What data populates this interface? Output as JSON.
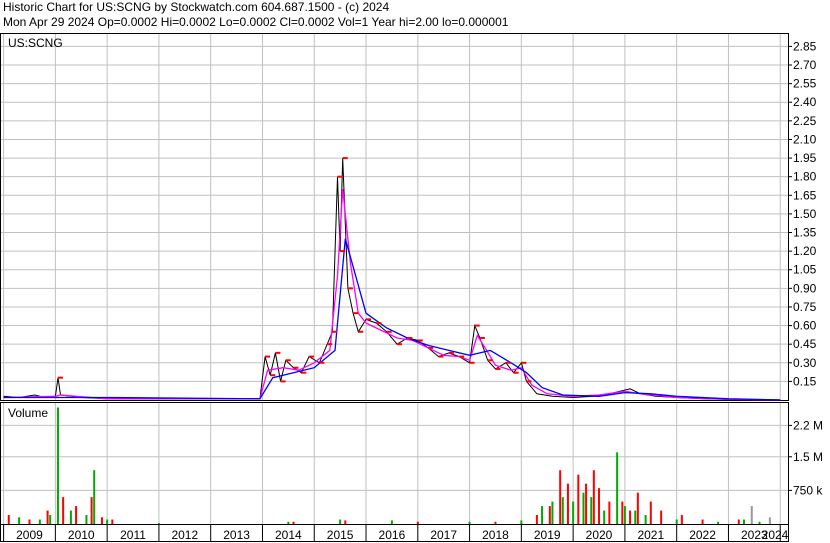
{
  "header": {
    "line1": "Historic Chart for US:SCNG by Stockwatch.com 604.687.1500 - (c) 2024",
    "line2": "Mon Apr 29 2024   Op=0.0002  Hi=0.0002  Lo=0.0002  Cl=0.0002  Vol=1   Year hi=2.00   lo=0.000001"
  },
  "colors": {
    "price": "#000000",
    "ma_short": "#ff00ff",
    "ma_long": "#0000ff",
    "marker": "#ff0000",
    "vol_up": "#00aa00",
    "vol_down": "#ff0000",
    "vol_flat": "#999999",
    "grid": "#c0c0c0"
  },
  "chart_data": [
    {
      "type": "line",
      "title": "US:SCNG",
      "ylim": [
        0,
        2.95
      ],
      "y_ticks": [
        "2.85",
        "2.70",
        "2.55",
        "2.40",
        "2.25",
        "2.10",
        "1.95",
        "1.80",
        "1.65",
        "1.50",
        "1.35",
        "1.20",
        "1.05",
        "0.90",
        "0.75",
        "0.60",
        "0.45",
        "0.30",
        "0.15"
      ],
      "x_ticks": [
        "2009",
        "2010",
        "2011",
        "2012",
        "2013",
        "2014",
        "2015",
        "2016",
        "2017",
        "2018",
        "2019",
        "2020",
        "2021",
        "2022",
        "2023",
        "2024"
      ],
      "series": [
        {
          "values": [
            [
              2009.0,
              0.03
            ],
            [
              2009.3,
              0.02
            ],
            [
              2009.6,
              0.04
            ],
            [
              2009.8,
              0.02
            ],
            [
              2010.0,
              0.03
            ],
            [
              2010.05,
              0.18
            ],
            [
              2010.1,
              0.04
            ],
            [
              2010.5,
              0.02
            ],
            [
              2011.0,
              0.01
            ],
            [
              2012.0,
              0.01
            ],
            [
              2013.0,
              0.01
            ],
            [
              2013.95,
              0.01
            ],
            [
              2014.05,
              0.35
            ],
            [
              2014.15,
              0.2
            ],
            [
              2014.25,
              0.38
            ],
            [
              2014.35,
              0.15
            ],
            [
              2014.45,
              0.32
            ],
            [
              2014.6,
              0.26
            ],
            [
              2014.75,
              0.22
            ],
            [
              2014.9,
              0.35
            ],
            [
              2015.1,
              0.3
            ],
            [
              2015.25,
              0.45
            ],
            [
              2015.35,
              0.55
            ],
            [
              2015.45,
              1.8
            ],
            [
              2015.5,
              1.2
            ],
            [
              2015.55,
              1.95
            ],
            [
              2015.65,
              0.9
            ],
            [
              2015.75,
              0.7
            ],
            [
              2015.85,
              0.55
            ],
            [
              2016.0,
              0.65
            ],
            [
              2016.2,
              0.62
            ],
            [
              2016.4,
              0.55
            ],
            [
              2016.6,
              0.45
            ],
            [
              2016.8,
              0.5
            ],
            [
              2017.0,
              0.48
            ],
            [
              2017.2,
              0.42
            ],
            [
              2017.4,
              0.35
            ],
            [
              2017.6,
              0.38
            ],
            [
              2017.8,
              0.35
            ],
            [
              2018.0,
              0.3
            ],
            [
              2018.1,
              0.6
            ],
            [
              2018.2,
              0.5
            ],
            [
              2018.35,
              0.32
            ],
            [
              2018.5,
              0.25
            ],
            [
              2018.7,
              0.3
            ],
            [
              2018.85,
              0.22
            ],
            [
              2019.0,
              0.3
            ],
            [
              2019.1,
              0.15
            ],
            [
              2019.3,
              0.05
            ],
            [
              2019.6,
              0.03
            ],
            [
              2020.0,
              0.02
            ],
            [
              2020.4,
              0.03
            ],
            [
              2020.7,
              0.05
            ],
            [
              2020.9,
              0.07
            ],
            [
              2021.1,
              0.09
            ],
            [
              2021.3,
              0.05
            ],
            [
              2021.6,
              0.03
            ],
            [
              2022.0,
              0.02
            ],
            [
              2022.5,
              0.01
            ],
            [
              2023.0,
              0.005
            ],
            [
              2024.0,
              0.0002
            ]
          ]
        },
        {
          "values": [
            [
              2009.0,
              0.02
            ],
            [
              2010.0,
              0.03
            ],
            [
              2010.1,
              0.04
            ],
            [
              2011.0,
              0.01
            ],
            [
              2013.95,
              0.01
            ],
            [
              2014.1,
              0.24
            ],
            [
              2014.4,
              0.26
            ],
            [
              2014.7,
              0.24
            ],
            [
              2015.0,
              0.3
            ],
            [
              2015.3,
              0.4
            ],
            [
              2015.45,
              1.0
            ],
            [
              2015.55,
              1.7
            ],
            [
              2015.7,
              1.1
            ],
            [
              2015.85,
              0.7
            ],
            [
              2016.0,
              0.62
            ],
            [
              2016.3,
              0.56
            ],
            [
              2016.6,
              0.5
            ],
            [
              2016.9,
              0.48
            ],
            [
              2017.2,
              0.42
            ],
            [
              2017.5,
              0.36
            ],
            [
              2017.8,
              0.35
            ],
            [
              2018.0,
              0.32
            ],
            [
              2018.15,
              0.52
            ],
            [
              2018.3,
              0.42
            ],
            [
              2018.5,
              0.28
            ],
            [
              2018.8,
              0.24
            ],
            [
              2019.0,
              0.26
            ],
            [
              2019.2,
              0.12
            ],
            [
              2019.5,
              0.05
            ],
            [
              2020.0,
              0.03
            ],
            [
              2020.5,
              0.04
            ],
            [
              2021.0,
              0.07
            ],
            [
              2021.3,
              0.05
            ],
            [
              2022.0,
              0.02
            ],
            [
              2023.0,
              0.006
            ],
            [
              2024.0,
              0.0003
            ]
          ]
        },
        {
          "values": [
            [
              2009.0,
              0.02
            ],
            [
              2011.0,
              0.02
            ],
            [
              2013.95,
              0.01
            ],
            [
              2014.2,
              0.18
            ],
            [
              2014.6,
              0.22
            ],
            [
              2015.0,
              0.26
            ],
            [
              2015.4,
              0.4
            ],
            [
              2015.6,
              1.3
            ],
            [
              2015.8,
              1.0
            ],
            [
              2016.0,
              0.7
            ],
            [
              2016.4,
              0.58
            ],
            [
              2016.8,
              0.5
            ],
            [
              2017.2,
              0.44
            ],
            [
              2017.6,
              0.4
            ],
            [
              2018.0,
              0.36
            ],
            [
              2018.4,
              0.4
            ],
            [
              2018.8,
              0.3
            ],
            [
              2019.1,
              0.22
            ],
            [
              2019.4,
              0.1
            ],
            [
              2019.8,
              0.04
            ],
            [
              2020.5,
              0.03
            ],
            [
              2021.0,
              0.06
            ],
            [
              2021.5,
              0.05
            ],
            [
              2022.0,
              0.03
            ],
            [
              2023.0,
              0.01
            ],
            [
              2024.0,
              0.001
            ]
          ]
        }
      ]
    },
    {
      "type": "bar",
      "title": "Volume",
      "ylim": [
        0,
        2700000
      ],
      "y_ticks": [
        "2.2 M",
        "1.5 M",
        "750 k"
      ],
      "series": [
        {
          "values": [
            [
              2009.3,
              0.15
            ],
            [
              2009.7,
              0.1
            ],
            [
              2009.9,
              0.2
            ],
            [
              2010.05,
              2.6
            ],
            [
              2010.3,
              0.3
            ],
            [
              2010.6,
              0.2
            ],
            [
              2010.75,
              1.2
            ],
            [
              2011.0,
              0.1
            ],
            [
              2012.0,
              0.02
            ],
            [
              2014.5,
              0.05
            ],
            [
              2015.5,
              0.1
            ],
            [
              2016.5,
              0.08
            ],
            [
              2018.0,
              0.05
            ],
            [
              2019.0,
              0.08
            ],
            [
              2019.4,
              0.4
            ],
            [
              2019.6,
              0.5
            ],
            [
              2019.8,
              0.6
            ],
            [
              2020.0,
              0.5
            ],
            [
              2020.2,
              0.7
            ],
            [
              2020.35,
              0.6
            ],
            [
              2020.6,
              0.3
            ],
            [
              2020.85,
              1.6
            ],
            [
              2021.0,
              0.4
            ],
            [
              2021.2,
              0.3
            ],
            [
              2021.4,
              0.2
            ],
            [
              2022.0,
              0.1
            ],
            [
              2022.8,
              0.05
            ],
            [
              2023.3,
              0.1
            ],
            [
              2023.6,
              0.05
            ]
          ]
        },
        {
          "values": [
            [
              2009.1,
              0.2
            ],
            [
              2009.5,
              0.1
            ],
            [
              2009.85,
              0.3
            ],
            [
              2010.15,
              0.6
            ],
            [
              2010.4,
              0.4
            ],
            [
              2010.7,
              0.6
            ],
            [
              2010.9,
              0.15
            ],
            [
              2011.1,
              0.1
            ],
            [
              2014.6,
              0.05
            ],
            [
              2015.6,
              0.08
            ],
            [
              2017.0,
              0.05
            ],
            [
              2018.5,
              0.05
            ],
            [
              2019.3,
              0.2
            ],
            [
              2019.55,
              0.4
            ],
            [
              2019.75,
              1.2
            ],
            [
              2019.9,
              0.9
            ],
            [
              2020.1,
              1.1
            ],
            [
              2020.25,
              0.9
            ],
            [
              2020.4,
              1.2
            ],
            [
              2020.5,
              0.8
            ],
            [
              2020.7,
              0.5
            ],
            [
              2020.95,
              0.5
            ],
            [
              2021.1,
              0.3
            ],
            [
              2021.25,
              0.7
            ],
            [
              2021.5,
              0.5
            ],
            [
              2021.7,
              0.3
            ],
            [
              2022.1,
              0.2
            ],
            [
              2022.5,
              0.1
            ],
            [
              2023.2,
              0.1
            ]
          ]
        },
        {
          "values": [
            [
              2023.45,
              0.4
            ],
            [
              2023.8,
              0.15
            ]
          ]
        }
      ]
    }
  ]
}
